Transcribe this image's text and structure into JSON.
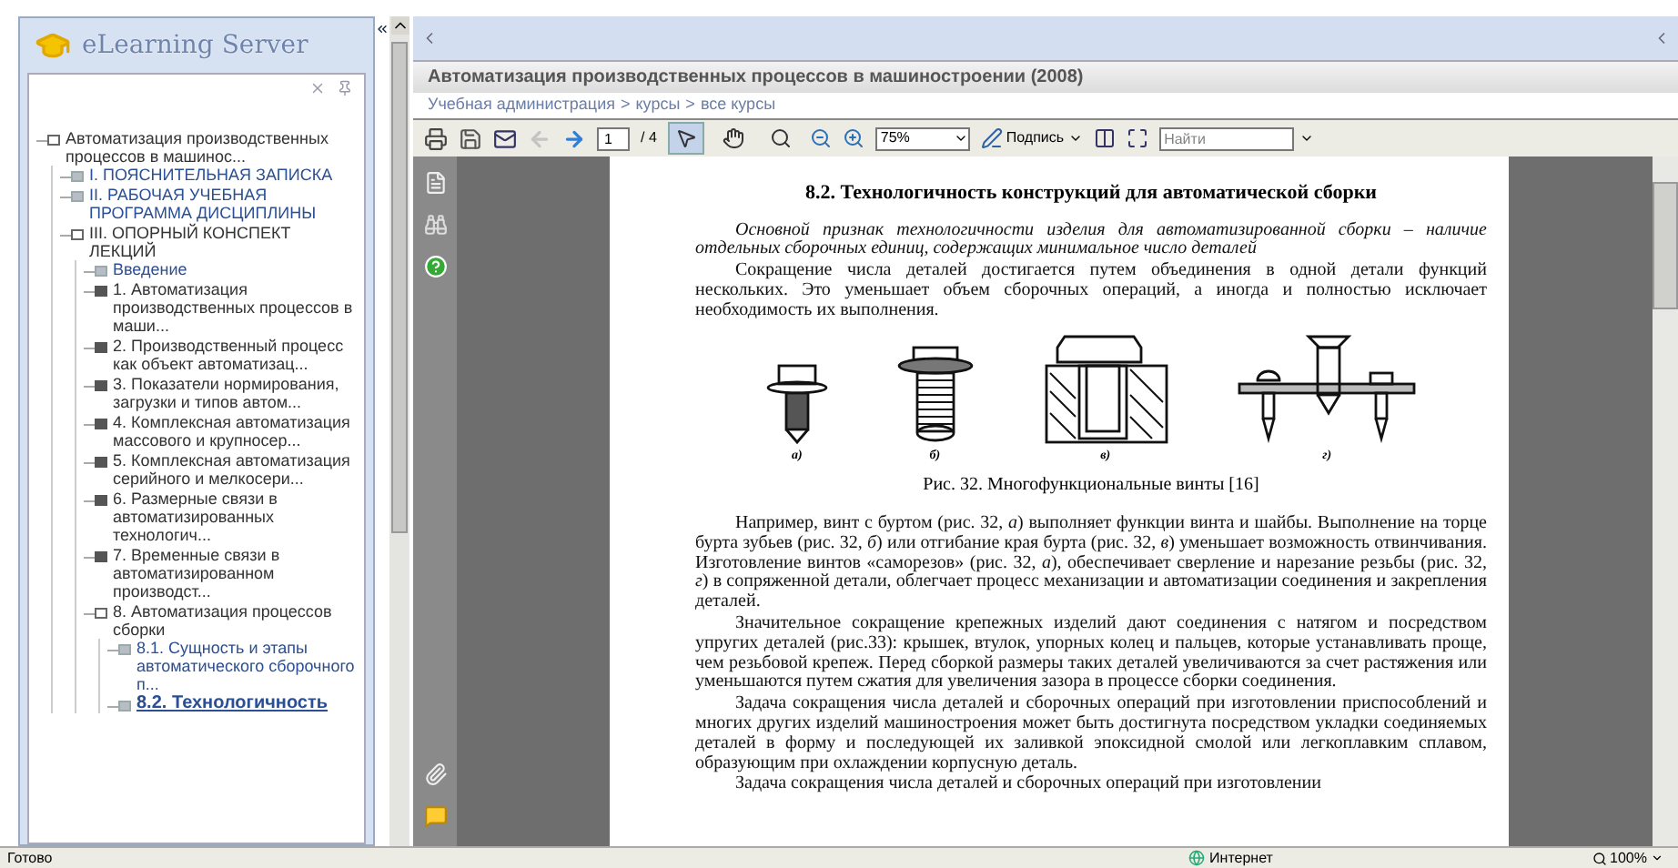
{
  "logo": {
    "text": "eLearning Server"
  },
  "tree": [
    {
      "label": "Автоматизация производственных процессов в машинос...",
      "kind": "section",
      "expanded": true,
      "selected": false,
      "children": [
        {
          "label": "I. ПОЯСНИТЕЛЬНАЯ ЗАПИСКА",
          "kind": "page",
          "expanded": false,
          "selected": false
        },
        {
          "label": "II. РАБОЧАЯ УЧЕБНАЯ ПРОГРАММА ДИСЦИПЛИНЫ",
          "kind": "page",
          "expanded": false,
          "selected": false
        },
        {
          "label": "III. ОПОРНЫЙ КОНСПЕКТ ЛЕКЦИЙ",
          "kind": "section",
          "expanded": true,
          "selected": false,
          "children": [
            {
              "label": "Введение",
              "kind": "page",
              "expanded": false,
              "selected": false
            },
            {
              "label": "1. Автоматизация производственных процессов в маши...",
              "kind": "section",
              "expanded": false,
              "selected": false
            },
            {
              "label": "2. Производственный процесс как объект автоматизац...",
              "kind": "section",
              "expanded": false,
              "selected": false
            },
            {
              "label": "3. Показатели нормирования, загрузки и типов автом...",
              "kind": "section",
              "expanded": false,
              "selected": false
            },
            {
              "label": "4. Комплексная автоматизация массового и крупносер...",
              "kind": "section",
              "expanded": false,
              "selected": false
            },
            {
              "label": "5. Комплексная автоматизация серийного и мелкосери...",
              "kind": "section",
              "expanded": false,
              "selected": false
            },
            {
              "label": "6. Размерные связи в автоматизированных технологич...",
              "kind": "section",
              "expanded": false,
              "selected": false
            },
            {
              "label": "7. Временные связи в автоматизированном производст...",
              "kind": "section",
              "expanded": false,
              "selected": false
            },
            {
              "label": "8. Автоматизация процессов сборки",
              "kind": "section",
              "expanded": true,
              "selected": false,
              "children": [
                {
                  "label": "8.1. Сущность и этапы автоматического сборочного п...",
                  "kind": "page",
                  "expanded": false,
                  "selected": false
                },
                {
                  "label": "8.2. Технологичность",
                  "kind": "page",
                  "expanded": false,
                  "selected": true
                }
              ]
            }
          ]
        }
      ]
    }
  ],
  "course": {
    "title": "Автоматизация производственных процессов в машиностроении (2008)",
    "breadcrumb": [
      "Учебная администрация",
      "курсы",
      "все курсы"
    ],
    "separator": ">"
  },
  "toolbar": {
    "nav": [
      {
        "kind": "back",
        "disabled": true
      },
      {
        "kind": "forward",
        "disabled": false
      }
    ],
    "page_input": "1",
    "page_count": "/ 4",
    "tools": [
      {
        "kind": "select",
        "selected": true
      },
      {
        "kind": "hand",
        "selected": false
      },
      {
        "kind": "zoom",
        "selected": false
      }
    ],
    "zoom": "75%",
    "sign_label": "Подпись",
    "search_placeholder": "Найти"
  },
  "document": {
    "title": "8.2. Технологичность конструкций для автоматической сборки",
    "paragraphs_before": [
      {
        "italic": true,
        "text": "Основной признак технологичности изделия для автоматизированной сборки – наличие отдельных сборочных единиц, содержащих минимальное число деталей"
      },
      {
        "italic": false,
        "text": "Сокращение числа деталей достигается путем объединения в одной детали функций нескольких. Это уменьшает объем сборочных операций, а иногда и полностью исключает необходимость их выполнения."
      }
    ],
    "figure": {
      "items": [
        {
          "kind": "flange-bolt",
          "label": "а)"
        },
        {
          "kind": "toothed-bolt",
          "label": "б)"
        },
        {
          "kind": "section",
          "label": "в)"
        },
        {
          "kind": "self-tapping",
          "label": "г)"
        }
      ],
      "caption": "Рис. 32. Многофункциональные винты [16]"
    },
    "paragraphs_after": [
      {
        "italic": false,
        "text": "Например, винт с буртом (рис. 32, *а*)  выполняет функции винта и шайбы. Выполнение на торце бурта зубьев  (рис. 32, *б*) или отгибание края бурта (рис. 32, *в*) уменьшает возможность отвинчивания. Изготовление винтов «саморезов» (рис. 32, *а*), обеспечивает сверление и нарезание резьбы (рис. 32, *г*) в сопряженной детали, облегчает процесс механизации и автоматизации соединения и закрепления деталей."
      },
      {
        "italic": false,
        "text": "Значительное сокращение крепежных изделий дают соединения с натягом и посредством упругих деталей (рис.33): крышек, втулок, упорных колец и пальцев, которые устанавливать проще, чем резьбовой крепеж. Перед сборкой размеры таких деталей увеличиваются за счет растяжения или уменьшаются путем сжатия для увеличения зазора в процессе сборки соединения."
      },
      {
        "italic": false,
        "text": "Задача сокращения числа деталей и сборочных операций при изготовлении приспособлений и многих других изделий машиностроения может быть достигнута посредством укладки соединяемых деталей в форму и последующей их заливкой эпоксидной смолой или легкоплавким сплавом, образующим при охлаждении корпусную деталь."
      },
      {
        "italic": false,
        "text": "Задача сокращения числа деталей и сборочных операций при изготовлении"
      }
    ]
  },
  "status_bar": {
    "text": "Готово",
    "zone": "Интернет",
    "zoom": "100%"
  }
}
